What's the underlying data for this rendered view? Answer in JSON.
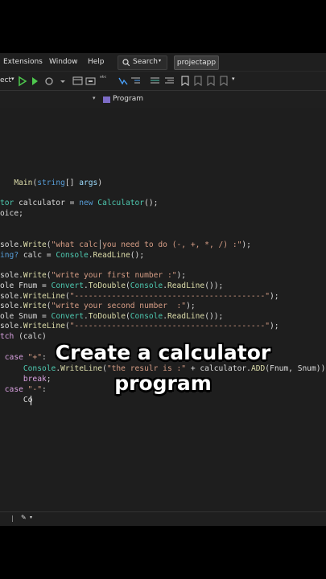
{
  "menubar": {
    "items": [
      "Extensions",
      "Window",
      "Help"
    ],
    "search_label": "Search",
    "project_label": "projectapp"
  },
  "toolbar": {
    "left_text": "ect"
  },
  "navbar": {
    "label": "Program"
  },
  "code": {
    "lines": [
      [
        [
          "kw",
          "  "
        ],
        [
          "mt",
          " Main"
        ],
        [
          "",
          "("
        ],
        [
          "kw",
          "string"
        ],
        [
          "",
          "[] "
        ],
        [
          "vr",
          "args"
        ],
        [
          "",
          ")"
        ]
      ],
      [],
      [
        [
          "ty",
          "tor"
        ],
        [
          "",
          " calculator = "
        ],
        [
          "kw",
          "new"
        ],
        [
          "",
          ""
        ],
        [
          "ty",
          " Calculator"
        ],
        [
          "",
          "();"
        ]
      ],
      [
        [
          "",
          "oice;"
        ]
      ],
      [],
      [],
      [
        [
          "",
          "sole."
        ],
        [
          "mt",
          "Write"
        ],
        [
          "",
          "("
        ],
        [
          "st",
          "\"what calc you need to do (-, +, *, /) :\""
        ],
        [
          "",
          ");"
        ]
      ],
      [
        [
          "kw",
          "ing?"
        ],
        [
          "",
          " calc = "
        ],
        [
          "ty",
          "Console"
        ],
        [
          "",
          "."
        ],
        [
          "mt",
          "ReadLine"
        ],
        [
          "",
          "();"
        ]
      ],
      [],
      [
        [
          "",
          "sole."
        ],
        [
          "mt",
          "Write"
        ],
        [
          "",
          "("
        ],
        [
          "st",
          "\"write your first number :\""
        ],
        [
          "",
          ");"
        ]
      ],
      [
        [
          "",
          "ole Fnum = "
        ],
        [
          "ty",
          "Convert"
        ],
        [
          "",
          "."
        ],
        [
          "mt",
          "ToDouble"
        ],
        [
          "",
          "("
        ],
        [
          "ty",
          "Console"
        ],
        [
          "",
          "."
        ],
        [
          "mt",
          "ReadLine"
        ],
        [
          "",
          "());"
        ]
      ],
      [
        [
          "",
          "sole."
        ],
        [
          "mt",
          "WriteLine"
        ],
        [
          "",
          "("
        ],
        [
          "st",
          "\"-----------------------------------------\""
        ],
        [
          "",
          ");"
        ]
      ],
      [
        [
          "",
          "sole."
        ],
        [
          "mt",
          "Write"
        ],
        [
          "",
          "("
        ],
        [
          "st",
          "\"write your second number  :\""
        ],
        [
          "",
          ");"
        ]
      ],
      [
        [
          "",
          "ole Snum = "
        ],
        [
          "ty",
          "Convert"
        ],
        [
          "",
          "."
        ],
        [
          "mt",
          "ToDouble"
        ],
        [
          "",
          "("
        ],
        [
          "ty",
          "Console"
        ],
        [
          "",
          "."
        ],
        [
          "mt",
          "ReadLine"
        ],
        [
          "",
          "());"
        ]
      ],
      [
        [
          "",
          "sole."
        ],
        [
          "mt",
          "WriteLine"
        ],
        [
          "",
          "("
        ],
        [
          "st",
          "\"-----------------------------------------\""
        ],
        [
          "",
          ");"
        ]
      ],
      [
        [
          "ct",
          "tch"
        ],
        [
          "",
          " (calc)"
        ]
      ],
      [],
      [
        [
          "ct",
          " case "
        ],
        [
          "st",
          "\"+\""
        ],
        [
          "",
          ":"
        ]
      ],
      [
        [
          "",
          ""
        ],
        [
          "ty",
          "     Console"
        ],
        [
          "",
          "."
        ],
        [
          "mt",
          "WriteLine"
        ],
        [
          "",
          "("
        ],
        [
          "st",
          "\"the resulr is :\""
        ],
        [
          "",
          " + calculator."
        ],
        [
          "mt",
          "ADD"
        ],
        [
          "",
          "(Fnum, Snum));"
        ]
      ],
      [
        [
          "ct",
          "     break"
        ],
        [
          "",
          ";"
        ]
      ],
      [
        [
          "ct",
          " case "
        ],
        [
          "st",
          "\"-\""
        ],
        [
          "",
          ":"
        ]
      ],
      [
        [
          "",
          "     Co"
        ]
      ]
    ]
  },
  "caption": {
    "line1": "Create a calculator",
    "line2": "program"
  },
  "colors": {
    "keyword": "#569cd6",
    "type": "#4ec9b0",
    "method": "#dcdcaa",
    "string": "#d69d85",
    "control": "#d8a0df"
  }
}
